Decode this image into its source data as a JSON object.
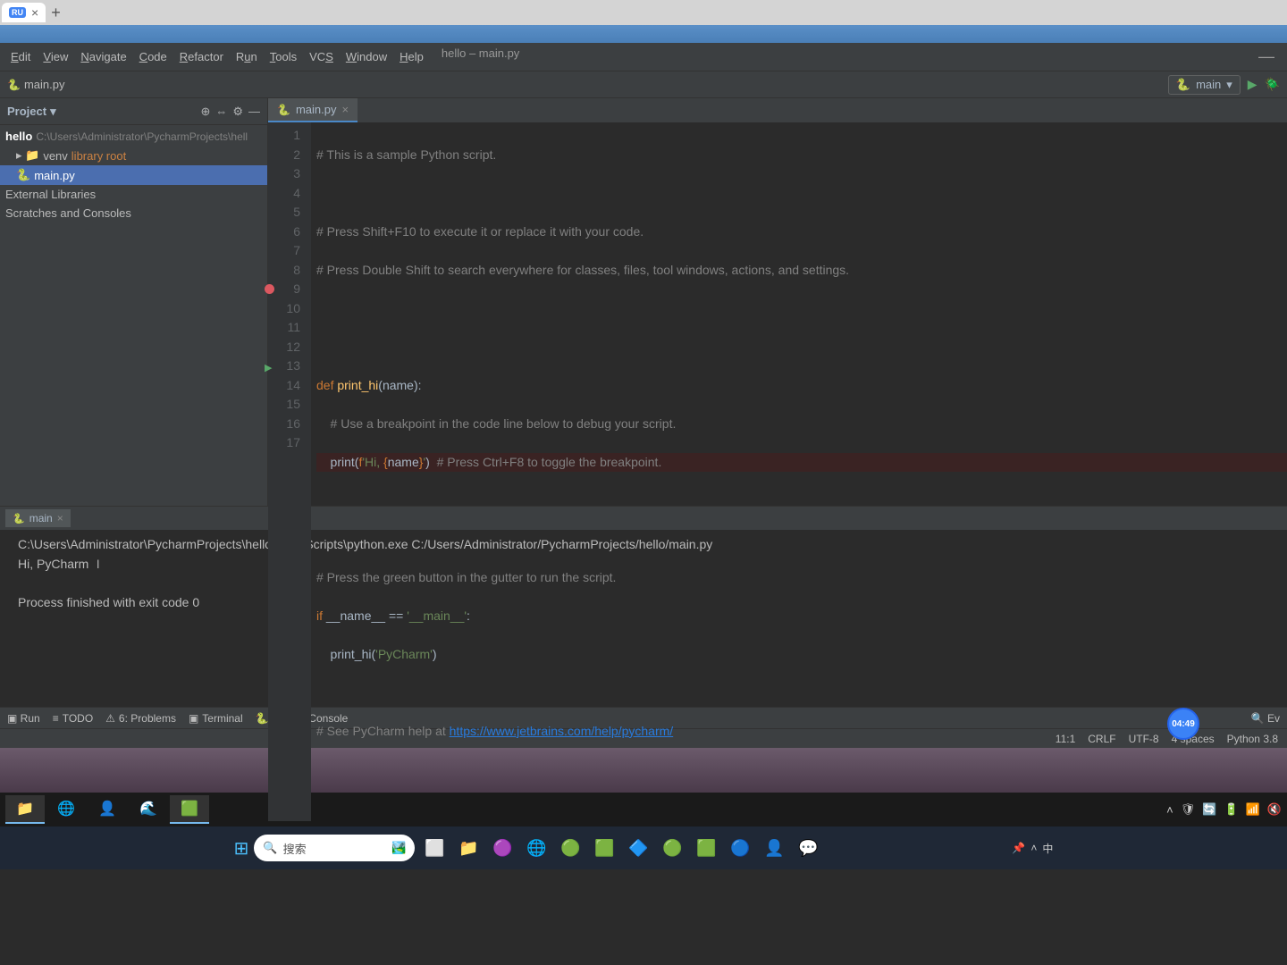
{
  "browser": {
    "tab_label": "RU",
    "close": "×",
    "new": "+"
  },
  "menubar": {
    "items": [
      "Edit",
      "View",
      "Navigate",
      "Code",
      "Refactor",
      "Run",
      "Tools",
      "VCS",
      "Window",
      "Help"
    ],
    "path": "hello – main.py",
    "minimize": "—"
  },
  "toolbar": {
    "breadcrumb_file": "main.py",
    "run_config": "main",
    "dropdown": "▾"
  },
  "sidebar": {
    "title": "Project",
    "dropdown": "▾",
    "project_name": "hello",
    "project_path": "C:\\Users\\Administrator\\PycharmProjects\\hell",
    "venv": "venv",
    "venv_label": "library root",
    "main_file": "main.py",
    "external": "External Libraries",
    "scratches": "Scratches and Consoles"
  },
  "editor": {
    "tab_name": "main.py",
    "tab_close": "×",
    "lines": {
      "l1": "# This is a sample Python script.",
      "l3": "# Press Shift+F10 to execute it or replace it with your code.",
      "l4": "# Press Double Shift to search everywhere for classes, files, tool windows, actions, and settings.",
      "l7_def": "def ",
      "l7_fn": "print_hi",
      "l7_rest": "(name):",
      "l8": "    # Use a breakpoint in the code line below to debug your script.",
      "l9_print": "    print(",
      "l9_f": "f",
      "l9_s1": "'Hi, ",
      "l9_b1": "{",
      "l9_name": "name",
      "l9_b2": "}",
      "l9_s2": "'",
      "l9_close": ")",
      "l9_c": "  # Press Ctrl+F8 to toggle the breakpoint.",
      "l12": "# Press the green button in the gutter to run the script.",
      "l13_if": "if ",
      "l13_name": "__name__",
      "l13_eq": " == ",
      "l13_str": "'__main__'",
      "l13_colon": ":",
      "l14_call": "    print_hi(",
      "l14_arg": "'PyCharm'",
      "l14_close": ")",
      "l16_c": "# See PyCharm help at ",
      "l16_link": "https://www.jetbrains.com/help/pycharm/"
    }
  },
  "run": {
    "tab": "main",
    "tab_close": "×",
    "line1": "C:\\Users\\Administrator\\PycharmProjects\\hello\\venv\\Scripts\\python.exe C:/Users/Administrator/PycharmProjects/hello/main.py",
    "line2": "Hi, PyCharm",
    "line4": "Process finished with exit code 0"
  },
  "bottom": {
    "todo": "TODO",
    "problems": "6: Problems",
    "terminal": "Terminal",
    "pyconsole": "Python Console",
    "event": "Ev",
    "time": "04:49"
  },
  "status": {
    "pos": "11:1",
    "ending": "CRLF",
    "encoding": "UTF-8",
    "indent": "4 spaces",
    "python": "Python 3.8"
  },
  "search_placeholder": "搜索",
  "tray": {
    "lang": "中"
  }
}
